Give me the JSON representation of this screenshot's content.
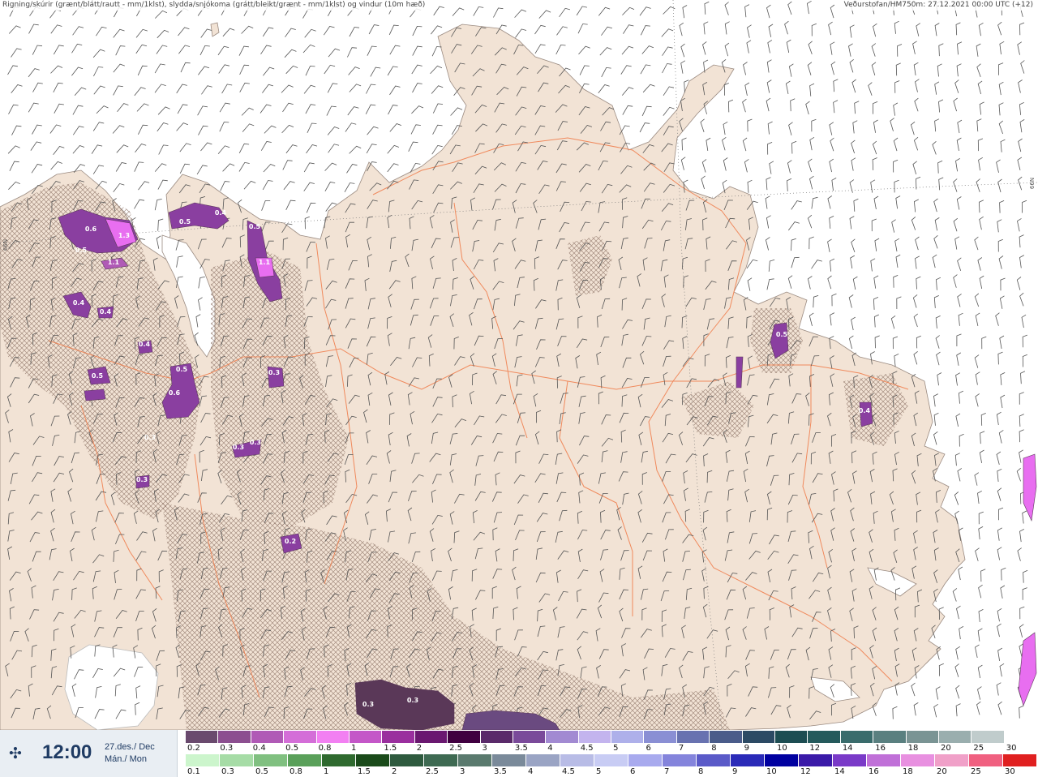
{
  "header": {
    "left_text": "Rigning/skúrir (grænt/blátt/rautt - mm/1klst), slydda/snjókoma (grátt/bleikt/grænt - mm/1klst) og vindur (10m hæð)",
    "right_text": "Veðurstofan/HM750m: 27.12.2021 00:00 UTC (+12)"
  },
  "map": {
    "latitude_tags": [
      "66N",
      "66N"
    ],
    "precip_labels": [
      "0.6",
      "1.3",
      "0.5",
      "1.1",
      "0.5",
      "0.4",
      "0.5",
      "1.1",
      "0.4",
      "0.4",
      "0.4",
      "0.5",
      "0.5",
      "0.6",
      "0.3",
      "0.3",
      "0.3",
      "0.3",
      "0.3",
      "0.2",
      "0.5",
      "0.4",
      "0.3",
      "0.3"
    ],
    "colors": {
      "sea": "#ffffff",
      "land": "#f2e3d5",
      "roads": "#f08050",
      "hatch": "#8a6f62",
      "precip_fill": "#8a3fa0",
      "precip_dark": "#5a3858",
      "precip_light": "#e86ef0"
    }
  },
  "footer": {
    "play_icon": "play-animation-icon",
    "time": "12:00",
    "date_line1": "27.des./ Dec",
    "date_line2": "Mán./ Mon",
    "rain_scale": {
      "labels": [
        "0.2",
        "0.3",
        "0.4",
        "0.5",
        "0.8",
        "1",
        "1.5",
        "2",
        "2.5",
        "3",
        "3.5",
        "4",
        "4.5",
        "5",
        "6",
        "7",
        "8",
        "9",
        "10",
        "12",
        "14",
        "16",
        "18",
        "20",
        "25",
        "30"
      ],
      "colors": [
        "#6a4a6e",
        "#8c4f90",
        "#b05ab6",
        "#d46ed8",
        "#f280f2",
        "#c457c8",
        "#9a2f9e",
        "#6a1870",
        "#400040",
        "#5a2a6a",
        "#7a4a9a",
        "#a28ad2",
        "#c3b4ee",
        "#aeb0ea",
        "#8a8fd4",
        "#6872b0",
        "#4a5c8a",
        "#2c4a64",
        "#1d4d52",
        "#255a5c",
        "#3a6c6c",
        "#5a8080",
        "#7a9494",
        "#9aaeae",
        "#c0cccc",
        "#ffffff"
      ]
    },
    "snow_scale": {
      "labels": [
        "0.1",
        "0.3",
        "0.5",
        "0.8",
        "1",
        "1.5",
        "2",
        "2.5",
        "3",
        "3.5",
        "4",
        "4.5",
        "5",
        "6",
        "7",
        "8",
        "9",
        "10",
        "12",
        "14",
        "16",
        "18",
        "20",
        "25",
        "30"
      ],
      "colors": [
        "#ccf5cc",
        "#a6dca6",
        "#80c080",
        "#5aa05a",
        "#2f6a2f",
        "#1a4a1a",
        "#2e5a3e",
        "#3e6a52",
        "#5a7a6e",
        "#7a8a9a",
        "#9aa4c4",
        "#b8bce6",
        "#c8ccf4",
        "#a8aaee",
        "#8484dc",
        "#5a5ac8",
        "#2a2ab8",
        "#0000a0",
        "#3a1aa8",
        "#7a3ac8",
        "#c070d8",
        "#e890e0",
        "#f0a0c8",
        "#f06080",
        "#e02020"
      ]
    }
  }
}
